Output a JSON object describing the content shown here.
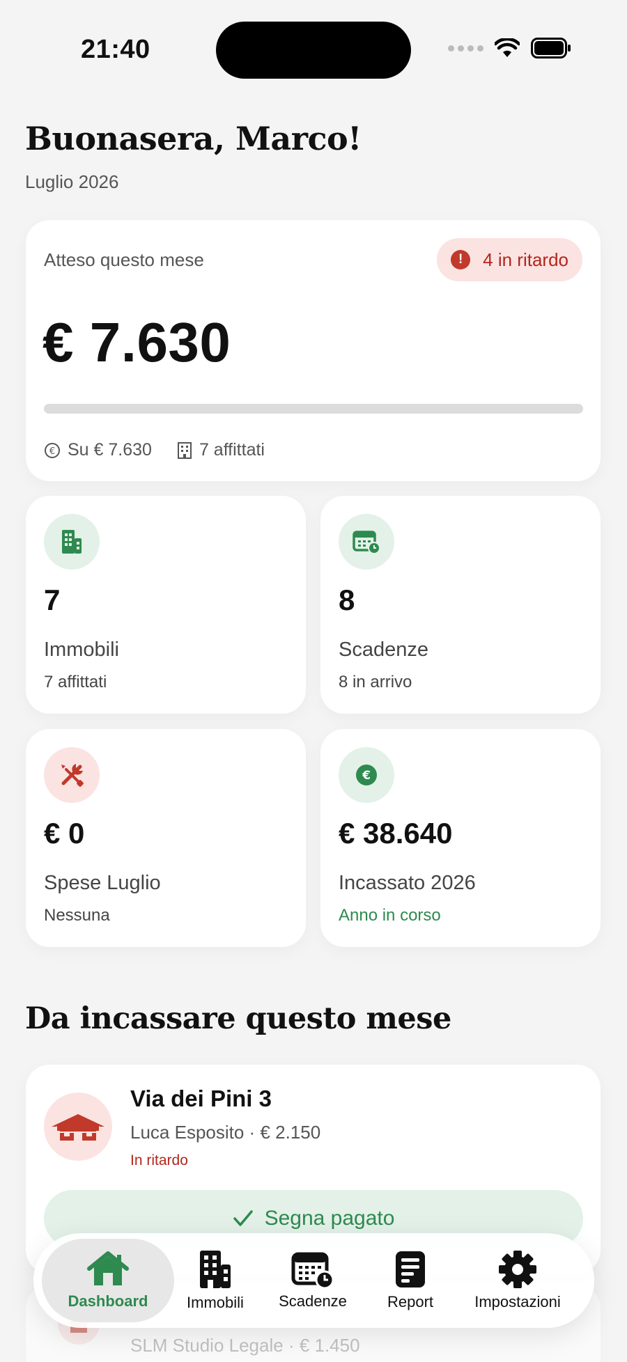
{
  "status_bar": {
    "time": "21:40"
  },
  "header": {
    "greeting": "Buonasera, Marco!",
    "month": "Luglio 2026"
  },
  "summary": {
    "label": "Atteso questo mese",
    "late_badge": "4 in ritardo",
    "amount": "€ 7.630",
    "progress_fraction": 0,
    "collected_of": "Su € 7.630",
    "rented": "7 affittati"
  },
  "stats": [
    {
      "icon": "building-icon",
      "value": "7",
      "label": "Immobili",
      "sub": "7 affittati"
    },
    {
      "icon": "calendar-clock-icon",
      "value": "8",
      "label": "Scadenze",
      "sub": "8 in arrivo"
    },
    {
      "icon": "tools-icon",
      "value": "€ 0",
      "label": "Spese Luglio",
      "sub": "Nessuna"
    },
    {
      "icon": "euro-icon",
      "value": "€ 38.640",
      "label": "Incassato 2026",
      "sub": "Anno in corso"
    }
  ],
  "section": {
    "title": "Da incassare questo mese"
  },
  "rent_items": [
    {
      "address": "Via dei Pini 3",
      "tenant": "Luca Esposito · € 2.150",
      "status": "In ritardo",
      "action": "Segna pagato"
    },
    {
      "tenant": "SLM Studio Legale · € 1.450"
    }
  ],
  "tabs": [
    {
      "label": "Dashboard",
      "icon": "home-icon",
      "active": true
    },
    {
      "label": "Immobili",
      "icon": "building-icon"
    },
    {
      "label": "Scadenze",
      "icon": "calendar-clock-icon"
    },
    {
      "label": "Report",
      "icon": "report-icon"
    },
    {
      "label": "Impostazioni",
      "icon": "gear-icon"
    }
  ],
  "colors": {
    "accent_green": "#2e8a4f",
    "alert_red": "#b3261e",
    "background": "#f4f4f4"
  }
}
